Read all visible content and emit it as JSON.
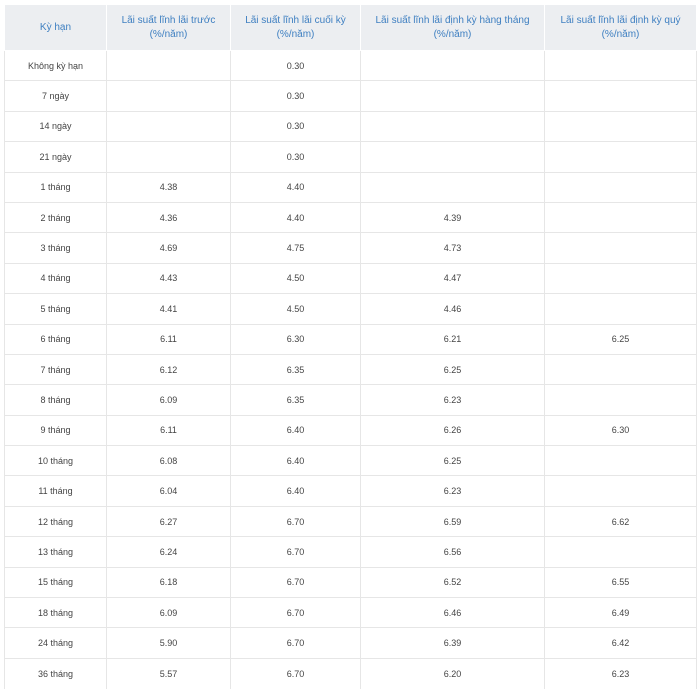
{
  "table": {
    "headers": [
      {
        "line1": "Kỳ hạn",
        "line2": ""
      },
      {
        "line1": "Lãi suất lĩnh lãi trước",
        "line2": "(%/năm)"
      },
      {
        "line1": "Lãi suất lĩnh lãi cuối kỳ",
        "line2": "(%/năm)"
      },
      {
        "line1": "Lãi suất lĩnh lãi định kỳ hàng tháng",
        "line2": "(%/năm)"
      },
      {
        "line1": "Lãi suất lĩnh lãi định kỳ quý",
        "line2": "(%/năm)"
      }
    ],
    "rows": [
      [
        "Không kỳ hạn",
        "",
        "0.30",
        "",
        ""
      ],
      [
        "7 ngày",
        "",
        "0.30",
        "",
        ""
      ],
      [
        "14 ngày",
        "",
        "0.30",
        "",
        ""
      ],
      [
        "21 ngày",
        "",
        "0.30",
        "",
        ""
      ],
      [
        "1 tháng",
        "4.38",
        "4.40",
        "",
        ""
      ],
      [
        "2 tháng",
        "4.36",
        "4.40",
        "4.39",
        ""
      ],
      [
        "3 tháng",
        "4.69",
        "4.75",
        "4.73",
        ""
      ],
      [
        "4 tháng",
        "4.43",
        "4.50",
        "4.47",
        ""
      ],
      [
        "5 tháng",
        "4.41",
        "4.50",
        "4.46",
        ""
      ],
      [
        "6 tháng",
        "6.11",
        "6.30",
        "6.21",
        "6.25"
      ],
      [
        "7 tháng",
        "6.12",
        "6.35",
        "6.25",
        ""
      ],
      [
        "8 tháng",
        "6.09",
        "6.35",
        "6.23",
        ""
      ],
      [
        "9 tháng",
        "6.11",
        "6.40",
        "6.26",
        "6.30"
      ],
      [
        "10 tháng",
        "6.08",
        "6.40",
        "6.25",
        ""
      ],
      [
        "11 tháng",
        "6.04",
        "6.40",
        "6.23",
        ""
      ],
      [
        "12 tháng",
        "6.27",
        "6.70",
        "6.59",
        "6.62"
      ],
      [
        "13 tháng",
        "6.24",
        "6.70",
        "6.56",
        ""
      ],
      [
        "15 tháng",
        "6.18",
        "6.70",
        "6.52",
        "6.55"
      ],
      [
        "18 tháng",
        "6.09",
        "6.70",
        "6.46",
        "6.49"
      ],
      [
        "24 tháng",
        "5.90",
        "6.70",
        "6.39",
        "6.42"
      ],
      [
        "36 tháng",
        "5.57",
        "6.70",
        "6.20",
        "6.23"
      ]
    ]
  }
}
